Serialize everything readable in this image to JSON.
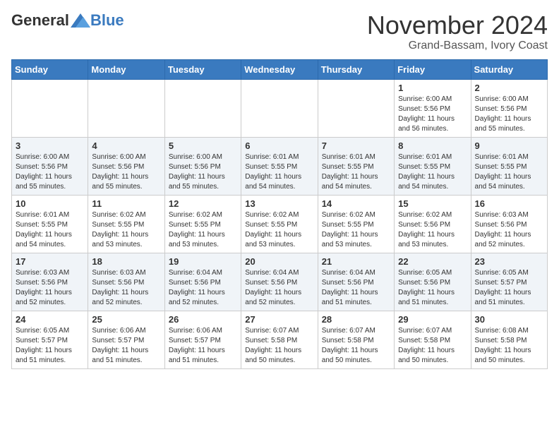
{
  "header": {
    "logo_general": "General",
    "logo_blue": "Blue",
    "month_title": "November 2024",
    "location": "Grand-Bassam, Ivory Coast"
  },
  "weekdays": [
    "Sunday",
    "Monday",
    "Tuesday",
    "Wednesday",
    "Thursday",
    "Friday",
    "Saturday"
  ],
  "weeks": [
    [
      {
        "day": "",
        "info": ""
      },
      {
        "day": "",
        "info": ""
      },
      {
        "day": "",
        "info": ""
      },
      {
        "day": "",
        "info": ""
      },
      {
        "day": "",
        "info": ""
      },
      {
        "day": "1",
        "info": "Sunrise: 6:00 AM\nSunset: 5:56 PM\nDaylight: 11 hours and 56 minutes."
      },
      {
        "day": "2",
        "info": "Sunrise: 6:00 AM\nSunset: 5:56 PM\nDaylight: 11 hours and 55 minutes."
      }
    ],
    [
      {
        "day": "3",
        "info": "Sunrise: 6:00 AM\nSunset: 5:56 PM\nDaylight: 11 hours and 55 minutes."
      },
      {
        "day": "4",
        "info": "Sunrise: 6:00 AM\nSunset: 5:56 PM\nDaylight: 11 hours and 55 minutes."
      },
      {
        "day": "5",
        "info": "Sunrise: 6:00 AM\nSunset: 5:56 PM\nDaylight: 11 hours and 55 minutes."
      },
      {
        "day": "6",
        "info": "Sunrise: 6:01 AM\nSunset: 5:55 PM\nDaylight: 11 hours and 54 minutes."
      },
      {
        "day": "7",
        "info": "Sunrise: 6:01 AM\nSunset: 5:55 PM\nDaylight: 11 hours and 54 minutes."
      },
      {
        "day": "8",
        "info": "Sunrise: 6:01 AM\nSunset: 5:55 PM\nDaylight: 11 hours and 54 minutes."
      },
      {
        "day": "9",
        "info": "Sunrise: 6:01 AM\nSunset: 5:55 PM\nDaylight: 11 hours and 54 minutes."
      }
    ],
    [
      {
        "day": "10",
        "info": "Sunrise: 6:01 AM\nSunset: 5:55 PM\nDaylight: 11 hours and 54 minutes."
      },
      {
        "day": "11",
        "info": "Sunrise: 6:02 AM\nSunset: 5:55 PM\nDaylight: 11 hours and 53 minutes."
      },
      {
        "day": "12",
        "info": "Sunrise: 6:02 AM\nSunset: 5:55 PM\nDaylight: 11 hours and 53 minutes."
      },
      {
        "day": "13",
        "info": "Sunrise: 6:02 AM\nSunset: 5:55 PM\nDaylight: 11 hours and 53 minutes."
      },
      {
        "day": "14",
        "info": "Sunrise: 6:02 AM\nSunset: 5:55 PM\nDaylight: 11 hours and 53 minutes."
      },
      {
        "day": "15",
        "info": "Sunrise: 6:02 AM\nSunset: 5:56 PM\nDaylight: 11 hours and 53 minutes."
      },
      {
        "day": "16",
        "info": "Sunrise: 6:03 AM\nSunset: 5:56 PM\nDaylight: 11 hours and 52 minutes."
      }
    ],
    [
      {
        "day": "17",
        "info": "Sunrise: 6:03 AM\nSunset: 5:56 PM\nDaylight: 11 hours and 52 minutes."
      },
      {
        "day": "18",
        "info": "Sunrise: 6:03 AM\nSunset: 5:56 PM\nDaylight: 11 hours and 52 minutes."
      },
      {
        "day": "19",
        "info": "Sunrise: 6:04 AM\nSunset: 5:56 PM\nDaylight: 11 hours and 52 minutes."
      },
      {
        "day": "20",
        "info": "Sunrise: 6:04 AM\nSunset: 5:56 PM\nDaylight: 11 hours and 52 minutes."
      },
      {
        "day": "21",
        "info": "Sunrise: 6:04 AM\nSunset: 5:56 PM\nDaylight: 11 hours and 51 minutes."
      },
      {
        "day": "22",
        "info": "Sunrise: 6:05 AM\nSunset: 5:56 PM\nDaylight: 11 hours and 51 minutes."
      },
      {
        "day": "23",
        "info": "Sunrise: 6:05 AM\nSunset: 5:57 PM\nDaylight: 11 hours and 51 minutes."
      }
    ],
    [
      {
        "day": "24",
        "info": "Sunrise: 6:05 AM\nSunset: 5:57 PM\nDaylight: 11 hours and 51 minutes."
      },
      {
        "day": "25",
        "info": "Sunrise: 6:06 AM\nSunset: 5:57 PM\nDaylight: 11 hours and 51 minutes."
      },
      {
        "day": "26",
        "info": "Sunrise: 6:06 AM\nSunset: 5:57 PM\nDaylight: 11 hours and 51 minutes."
      },
      {
        "day": "27",
        "info": "Sunrise: 6:07 AM\nSunset: 5:58 PM\nDaylight: 11 hours and 50 minutes."
      },
      {
        "day": "28",
        "info": "Sunrise: 6:07 AM\nSunset: 5:58 PM\nDaylight: 11 hours and 50 minutes."
      },
      {
        "day": "29",
        "info": "Sunrise: 6:07 AM\nSunset: 5:58 PM\nDaylight: 11 hours and 50 minutes."
      },
      {
        "day": "30",
        "info": "Sunrise: 6:08 AM\nSunset: 5:58 PM\nDaylight: 11 hours and 50 minutes."
      }
    ]
  ]
}
